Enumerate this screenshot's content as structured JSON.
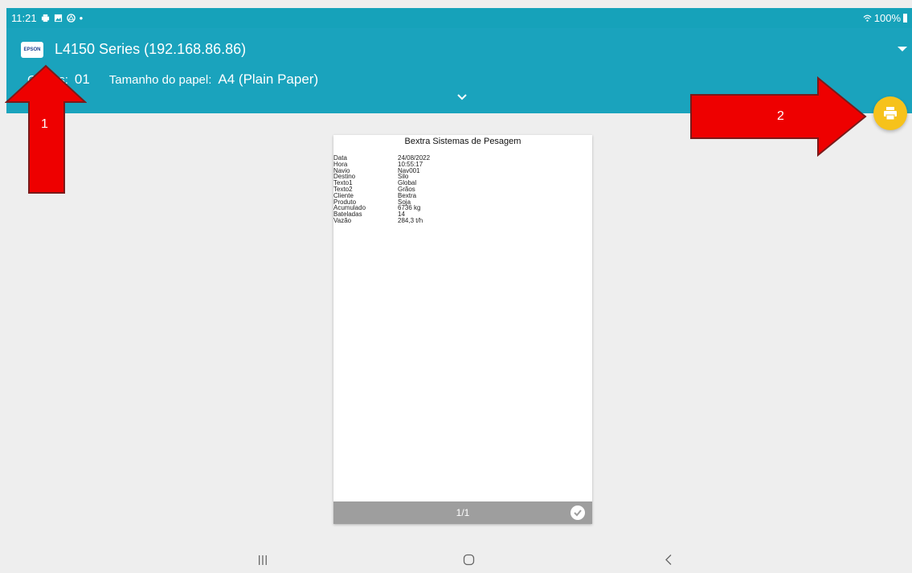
{
  "status_bar": {
    "time": "11:21",
    "battery": "100%"
  },
  "printer": {
    "brand": "EPSON",
    "name": "L4150 Series (192.168.86.86)"
  },
  "settings": {
    "copies_label": "Cópias:",
    "copies_value": "01",
    "paper_size_label": "Tamanho do papel:",
    "paper_size_value": "A4 (Plain Paper)"
  },
  "document": {
    "title": "Bextra Sistemas de Pesagem",
    "rows": [
      {
        "k": "Data",
        "v": "24/08/2022"
      },
      {
        "k": "Hora",
        "v": "10:55:17"
      },
      {
        "k": "Navio",
        "v": "Nav001"
      },
      {
        "k": "Destino",
        "v": "Silo"
      },
      {
        "k": "Texto1",
        "v": "Global"
      },
      {
        "k": "Texto2",
        "v": "Grãos"
      },
      {
        "k": "Cliente",
        "v": "Bextra"
      },
      {
        "k": "Produto",
        "v": "Soja"
      },
      {
        "k": "Acumulado",
        "v": "6736 kg"
      },
      {
        "k": "Bateladas",
        "v": "14"
      },
      {
        "k": "Vazão",
        "v": "284,3 t/h"
      }
    ]
  },
  "page_indicator": "1/1",
  "annotations": {
    "arrow1_label": "1",
    "arrow2_label": "2"
  },
  "colors": {
    "header": "#1aa3bd",
    "fab": "#f6c21b",
    "arrow": "#ee0000"
  }
}
